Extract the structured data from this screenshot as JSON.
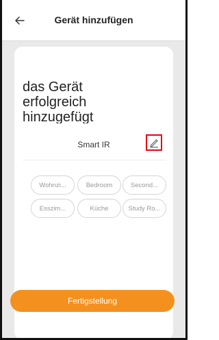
{
  "header": {
    "back_icon": "arrow-left-icon",
    "title": "Gerät hinzufügen"
  },
  "main": {
    "headline": "das Gerät erfolgreich hinzugefügt",
    "device_name": "Smart IR",
    "edit_icon": "pencil-icon",
    "rooms": [
      "Wohnzi...",
      "Bedroom",
      "Second...",
      "Esszim...",
      "Küche",
      "Study Ro..."
    ],
    "finish_label": "Fertigstellung"
  },
  "colors": {
    "accent": "#f4901d",
    "highlight": "#e8000d",
    "background": "#e9e9e9"
  }
}
